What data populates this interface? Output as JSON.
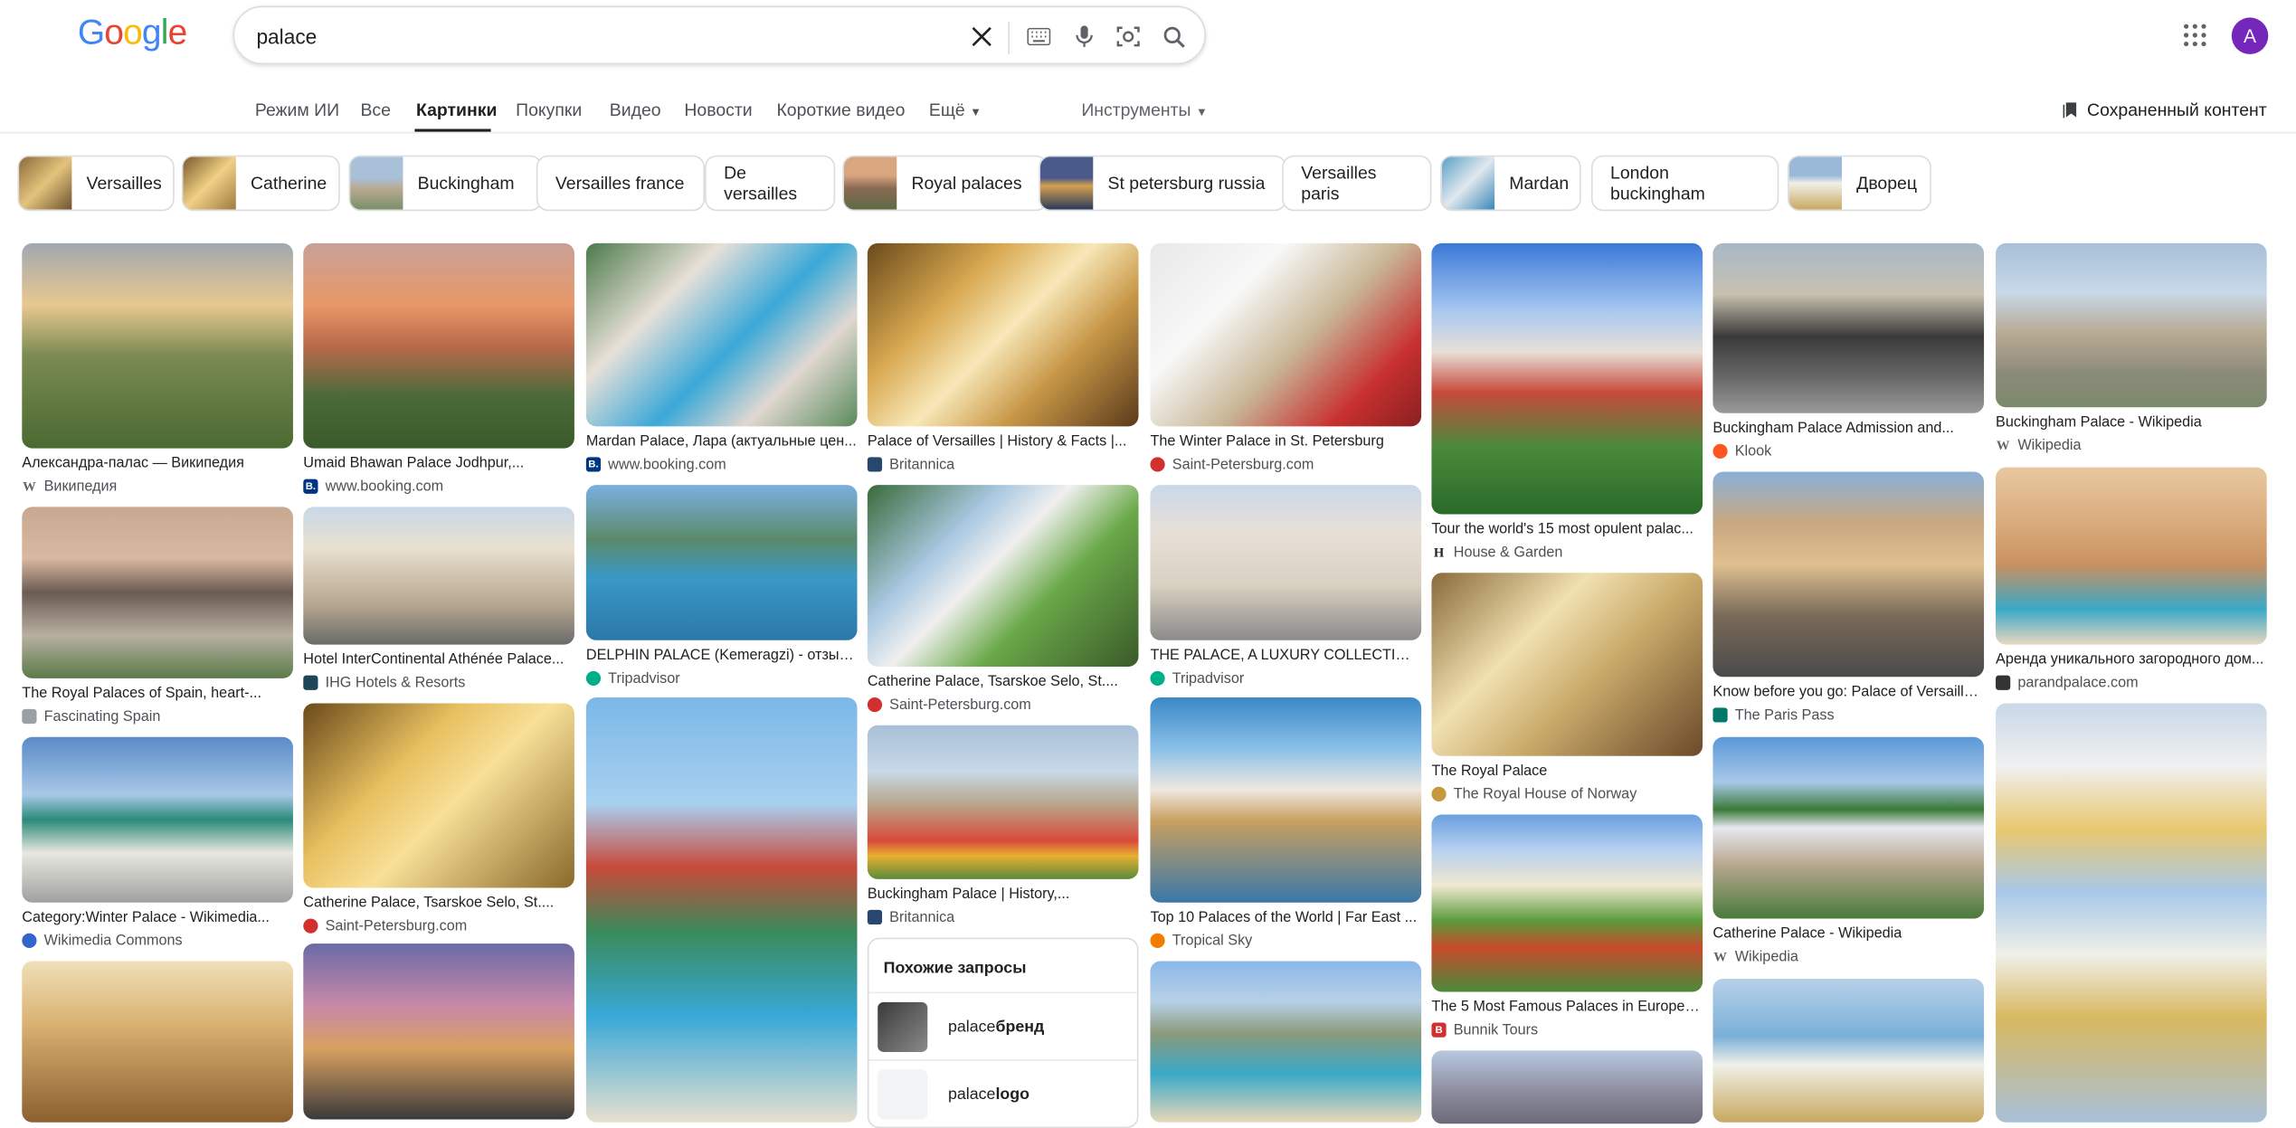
{
  "search": {
    "query": "palace"
  },
  "user": {
    "initial": "A"
  },
  "tabs": [
    "Режим ИИ",
    "Все",
    "Картинки",
    "Покупки",
    "Видео",
    "Новости",
    "Короткие видео",
    "Ещё"
  ],
  "tools_label": "Инструменты",
  "saved_label": "Сохраненный контент",
  "chips": [
    "Versailles",
    "Catherine",
    "Buckingham",
    "Versailles france",
    "De versailles",
    "Royal palaces",
    "St petersburg russia",
    "Versailles paris",
    "Mardan",
    "London buckingham",
    "Дворец"
  ],
  "results": [
    {
      "caption": "Александра-палас — Википедия",
      "source": "Википедия",
      "fav": "W",
      "favColor": "#5f6368"
    },
    {
      "caption": "The Royal Palaces of Spain, heart-...",
      "source": "Fascinating Spain",
      "fav": "",
      "favColor": "#9aa0a6"
    },
    {
      "caption": "Category:Winter Palace - Wikimedia...",
      "source": "Wikimedia Commons",
      "fav": "",
      "favColor": "#3366cc"
    },
    {
      "caption": "",
      "source": "",
      "fav": "",
      "favColor": ""
    },
    {
      "caption": "Umaid Bhawan Palace Jodhpur,...",
      "source": "www.booking.com",
      "fav": "B.",
      "favColor": "#003580"
    },
    {
      "caption": "Hotel InterContinental Athénée Palace...",
      "source": "IHG Hotels & Resorts",
      "fav": "",
      "favColor": "#1e4458"
    },
    {
      "caption": "Catherine Palace, Tsarskoe Selo, St....",
      "source": "Saint-Petersburg.com",
      "fav": "",
      "favColor": "#d32f2f"
    },
    {
      "caption": "",
      "source": "",
      "fav": "",
      "favColor": ""
    },
    {
      "caption": "Mardan Palace, Лара (актуальные цен...",
      "source": "www.booking.com",
      "fav": "B.",
      "favColor": "#003580"
    },
    {
      "caption": "DELPHIN PALACE (Kemeragzi) - отзыв...",
      "source": "Tripadvisor",
      "fav": "",
      "favColor": "#00af87"
    },
    {
      "caption": "",
      "source": "",
      "fav": "",
      "favColor": ""
    },
    {
      "caption": "Palace of Versailles | History & Facts |...",
      "source": "Britannica",
      "fav": "",
      "favColor": "#27476e"
    },
    {
      "caption": "Catherine Palace, Tsarskoe Selo, St....",
      "source": "Saint-Petersburg.com",
      "fav": "",
      "favColor": "#d32f2f"
    },
    {
      "caption": "Buckingham Palace | History,...",
      "source": "Britannica",
      "fav": "",
      "favColor": "#27476e"
    },
    {
      "caption": "The Winter Palace in St. Petersburg",
      "source": "Saint-Petersburg.com",
      "fav": "",
      "favColor": "#d32f2f"
    },
    {
      "caption": "THE PALACE, A LUXURY COLLECTION...",
      "source": "Tripadvisor",
      "fav": "",
      "favColor": "#00af87"
    },
    {
      "caption": "Top 10 Palaces of the World | Far East ...",
      "source": "Tropical Sky",
      "fav": "",
      "favColor": "#f57c00"
    },
    {
      "caption": "",
      "source": "",
      "fav": "",
      "favColor": ""
    },
    {
      "caption": "Tour the world's 15 most opulent palac...",
      "source": "House & Garden",
      "fav": "H",
      "favColor": "#202124"
    },
    {
      "caption": "The Royal Palace",
      "source": "The Royal House of Norway",
      "fav": "",
      "favColor": "#c49a3c"
    },
    {
      "caption": "The 5 Most Famous Palaces in Europe |...",
      "source": "Bunnik Tours",
      "fav": "B",
      "favColor": "#d32f2f"
    },
    {
      "caption": "",
      "source": "",
      "fav": "",
      "favColor": ""
    },
    {
      "caption": "Buckingham Palace Admission and...",
      "source": "Klook",
      "fav": "",
      "favColor": "#ff5722"
    },
    {
      "caption": "Know before you go: Palace of Versaille...",
      "source": "The Paris Pass",
      "fav": "",
      "favColor": "#00796b"
    },
    {
      "caption": "Catherine Palace - Wikipedia",
      "source": "Wikipedia",
      "fav": "W",
      "favColor": "#5f6368"
    },
    {
      "caption": "",
      "source": "",
      "fav": "",
      "favColor": ""
    },
    {
      "caption": "Buckingham Palace - Wikipedia",
      "source": "Wikipedia",
      "fav": "W",
      "favColor": "#5f6368"
    },
    {
      "caption": "Аренда уникального загородного дом...",
      "source": "parandpalace.com",
      "fav": "",
      "favColor": "#333333"
    },
    {
      "caption": "",
      "source": "",
      "fav": "",
      "favColor": ""
    }
  ],
  "related": {
    "title": "Похожие запросы",
    "items": [
      {
        "plain": "palace ",
        "bold": "бренд"
      },
      {
        "plain": "palace ",
        "bold": "logo"
      }
    ]
  }
}
